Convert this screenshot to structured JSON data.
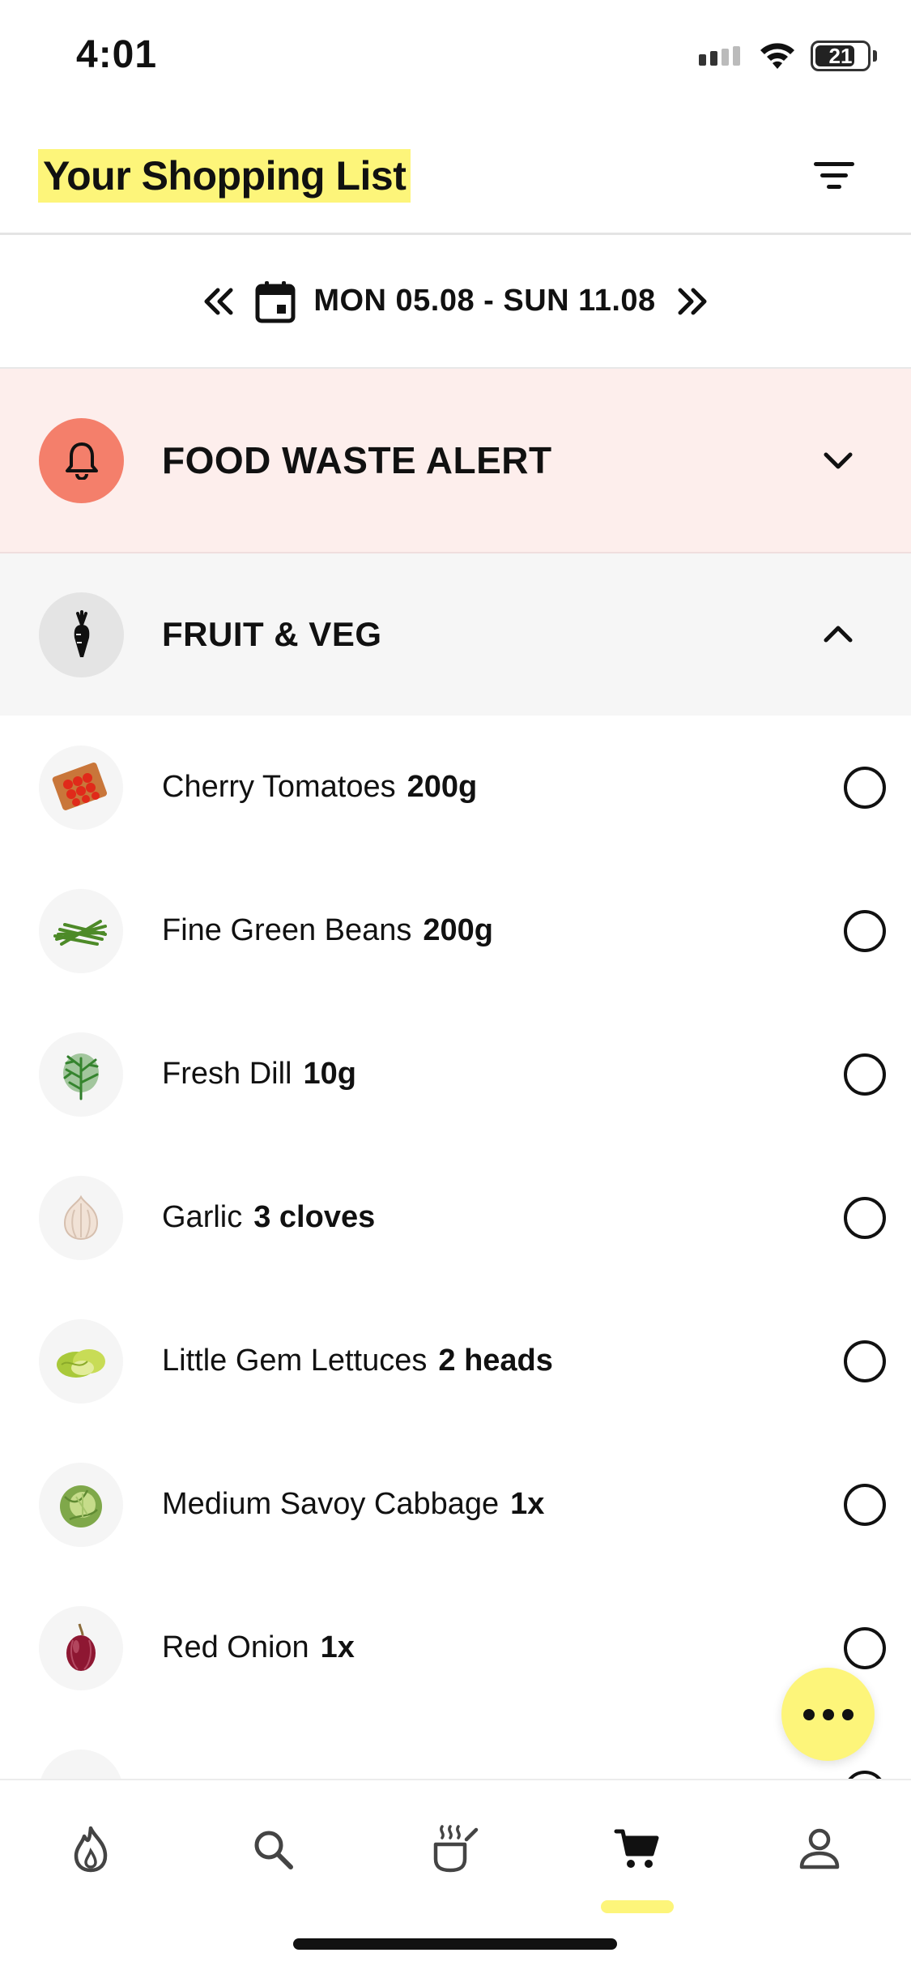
{
  "status_bar": {
    "time": "4:01",
    "battery": "21"
  },
  "header": {
    "title": "Your Shopping List"
  },
  "week_nav": {
    "label": "MON 05.08 - SUN 11.08"
  },
  "alert": {
    "title": "FOOD WASTE ALERT"
  },
  "category": {
    "title": "FRUIT & VEG"
  },
  "items": [
    {
      "name": "Cherry Tomatoes",
      "qty": "200g",
      "icon": "cherry-tomatoes"
    },
    {
      "name": "Fine Green Beans",
      "qty": "200g",
      "icon": "green-beans"
    },
    {
      "name": "Fresh Dill",
      "qty": "10g",
      "icon": "dill"
    },
    {
      "name": "Garlic",
      "qty": "3 cloves",
      "icon": "garlic"
    },
    {
      "name": "Little Gem Lettuces",
      "qty": "2 heads",
      "icon": "lettuce"
    },
    {
      "name": "Medium Savoy Cabbage",
      "qty": "1x",
      "icon": "cabbage"
    },
    {
      "name": "Red Onion",
      "qty": "1x",
      "icon": "red-onion"
    },
    {
      "name": "",
      "qty": "",
      "icon": "lemon"
    }
  ],
  "tabs": [
    {
      "name": "discover",
      "icon": "flame-icon"
    },
    {
      "name": "search",
      "icon": "search-icon"
    },
    {
      "name": "cook",
      "icon": "pot-icon"
    },
    {
      "name": "shopping-list",
      "icon": "cart-icon",
      "active": true
    },
    {
      "name": "profile",
      "icon": "profile-icon"
    }
  ],
  "colors": {
    "accent": "#fdf57a",
    "alert_bg": "#fdeeec",
    "alert_icon": "#f47f6b"
  }
}
